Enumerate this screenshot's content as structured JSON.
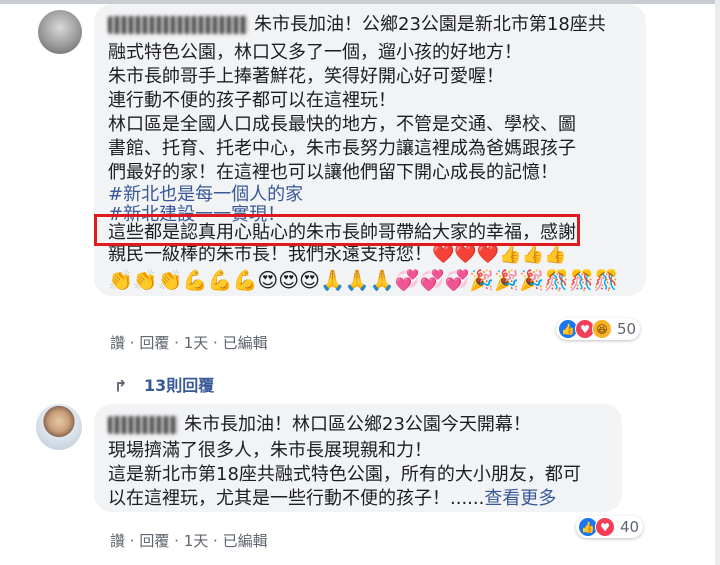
{
  "comment1": {
    "author": "Charles Huang",
    "lines": [
      "朱市長加油！公鄉23公園是新北市第18座共",
      "融式特色公園，林口又多了一個，遛小孩的好地方！",
      "朱市長帥哥手上捧著鮮花，笑得好開心好可愛喔！",
      "連行動不便的孩子都可以在這裡玩！",
      "林口區是全國人口成長最快的地方，不管是交通、學校、圖",
      "書館、托育、托老中心，朱市長努力讓這裡成為爸媽跟孩子",
      "們最好的家！在這裡也可以讓他們留下開心成長的記憶！"
    ],
    "hashtags": [
      "#新北也是每一個人的家",
      "#新北建設一一實現！"
    ],
    "highlighted": "這些都是認真用心貼心的朱市長帥哥帶給大家的幸福",
    "after_highlight": "，感謝",
    "line_last": "親民一級棒的朱市長！我們永遠支持您！",
    "emoji_line1": "❤️❤️❤️👍👍👍",
    "emoji_line2": "👏👏👏💪💪💪😍😍😍🙏🙏🙏💞💞💞🎉🎉🎉🎊🎊🎊",
    "reactions": {
      "count": "50",
      "icons": [
        "like-icon",
        "love-icon",
        "haha-icon"
      ]
    },
    "actions": {
      "like": "讚",
      "sep": "·",
      "reply": "回覆",
      "time": "1天",
      "edited": "已編輯"
    }
  },
  "replies_link": "13則回覆",
  "comment2": {
    "author": "Hsu Chin-jung",
    "lines": [
      "朱市長加油！林口區公鄉23公園今天開幕！",
      "現場擠滿了很多人，朱市長展現親和力！",
      "這是新北市第18座共融式特色公園，所有的大小朋友，都可",
      "以在這裡玩，尤其是一些行動不便的孩子！......"
    ],
    "see_more": "查看更多",
    "reactions": {
      "count": "40",
      "icons": [
        "like-icon",
        "love-icon"
      ]
    },
    "actions": {
      "like": "讚",
      "sep": "·",
      "reply": "回覆",
      "time": "1天",
      "edited": "已編輯"
    }
  },
  "colors": {
    "bubble": "#f2f3f5",
    "link": "#385898",
    "highlight_border": "#e0191e",
    "meta": "#606770"
  }
}
